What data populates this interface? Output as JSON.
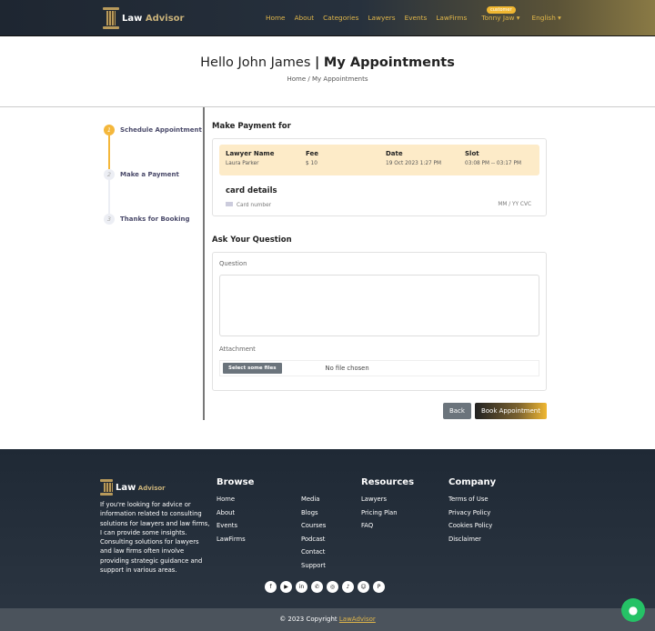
{
  "brand": {
    "name_a": "Law",
    "name_b": "Advisor"
  },
  "nav": {
    "items": [
      "Home",
      "About",
      "Categories",
      "Lawyers",
      "Events",
      "LawFirms"
    ],
    "user": "Tonny Jaw ▾",
    "user_badge": "customer",
    "language": "English ▾"
  },
  "hero": {
    "greeting": "Hello",
    "name": "John James",
    "sep": "|",
    "title": "My Appointments",
    "crumb_home": "Home",
    "crumb_sep": "/",
    "crumb_current": "My Appointments"
  },
  "steps": [
    {
      "num": "1",
      "label": "Schedule Appointment"
    },
    {
      "num": "2",
      "label": "Make a Payment"
    },
    {
      "num": "3",
      "label": "Thanks for Booking"
    }
  ],
  "payment": {
    "heading": "Make Payment for",
    "headers": [
      "Lawyer Name",
      "Fee",
      "Date",
      "Slot"
    ],
    "values": [
      "Laura Parker",
      "$ 10",
      "19 Oct 2023 1:27 PM",
      "03:08 PM -- 03:17 PM"
    ],
    "card_title": "card details",
    "card_placeholder": "Card number",
    "card_exp": "MM / YY  CVC"
  },
  "question": {
    "heading": "Ask Your Question",
    "label": "Question",
    "attachment_label": "Attachment",
    "file_button": "Select some files",
    "file_status": "No file chosen"
  },
  "buttons": {
    "back": "Back",
    "book": "Book Appointment"
  },
  "footer": {
    "about": "If you're looking for advice or information related to consulting solutions for lawyers and law firms, I can provide some insights. Consulting solutions for lawyers and law firms often involve providing strategic guidance and support in various areas.",
    "browse": "Browse",
    "browse_a": [
      "Home",
      "About",
      "Events",
      "LawFirms"
    ],
    "browse_b": [
      "Media",
      "Blogs",
      "Courses",
      "Podcast",
      "Contact",
      "Support"
    ],
    "resources": "Resources",
    "resources_items": [
      "Lawyers",
      "Pricing Plan",
      "FAQ"
    ],
    "company": "Company",
    "company_items": [
      "Terms of Use",
      "Privacy Policy",
      "Cookies Policy",
      "Disclaimer"
    ],
    "social": [
      "facebook",
      "youtube",
      "linkedin",
      "whatsapp",
      "instagram",
      "tiktok",
      "snapchat",
      "pinterest"
    ],
    "copyright": "© 2023 Copyright",
    "copyright_link": "LawAdvisor"
  }
}
